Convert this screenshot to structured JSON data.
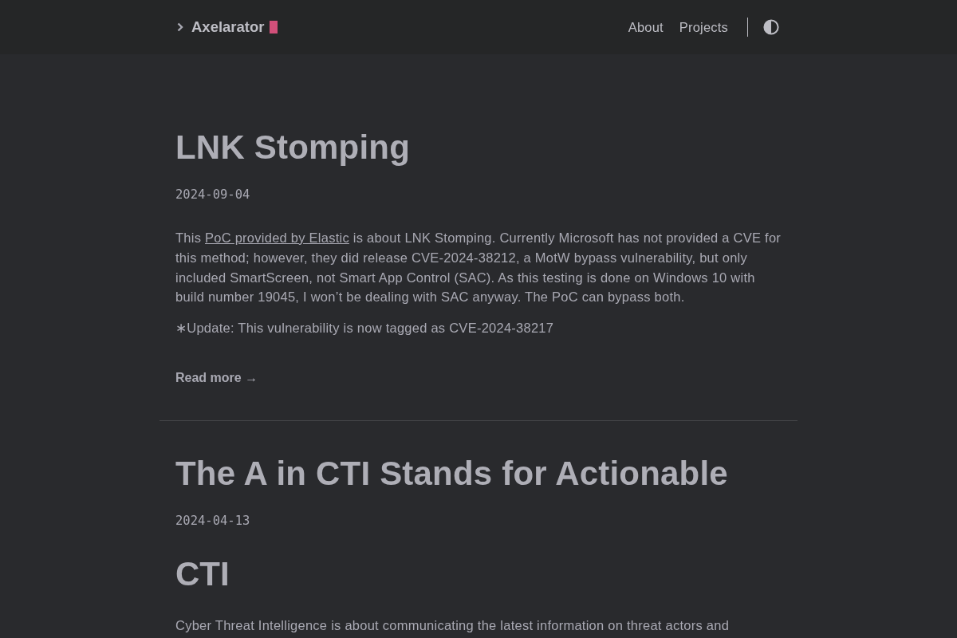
{
  "header": {
    "logo": "Axelarator",
    "nav": [
      {
        "label": "About"
      },
      {
        "label": "Projects"
      }
    ]
  },
  "posts": [
    {
      "title": "LNK Stomping",
      "date": "2024-09-04",
      "body": [
        {
          "kind": "paragraph",
          "segments": [
            {
              "kind": "text",
              "text": "This "
            },
            {
              "kind": "link",
              "text": "PoC provided by Elastic"
            },
            {
              "kind": "text",
              "text": " is about LNK Stomping. Currently Microsoft has not provided a CVE for this method; however, they did release CVE-2024-38212, a MotW bypass vulnerability, but only included SmartScreen, not Smart App Control (SAC). As this testing is done on Windows 10 with build number 19045, I won’t be dealing with SAC anyway. The PoC can bypass both."
            }
          ]
        },
        {
          "kind": "paragraph",
          "segments": [
            {
              "kind": "text",
              "text": "∗Update: This vulnerability is now tagged as CVE-2024-38217"
            }
          ]
        }
      ],
      "read_more": "Read more →"
    },
    {
      "title": "The A in CTI Stands for Actionable",
      "date": "2024-04-13",
      "body": [
        {
          "kind": "heading",
          "text": "CTI"
        },
        {
          "kind": "paragraph",
          "segments": [
            {
              "kind": "text",
              "text": "Cyber Threat Intelligence is about communicating the latest information on threat actors and"
            }
          ]
        }
      ]
    }
  ]
}
